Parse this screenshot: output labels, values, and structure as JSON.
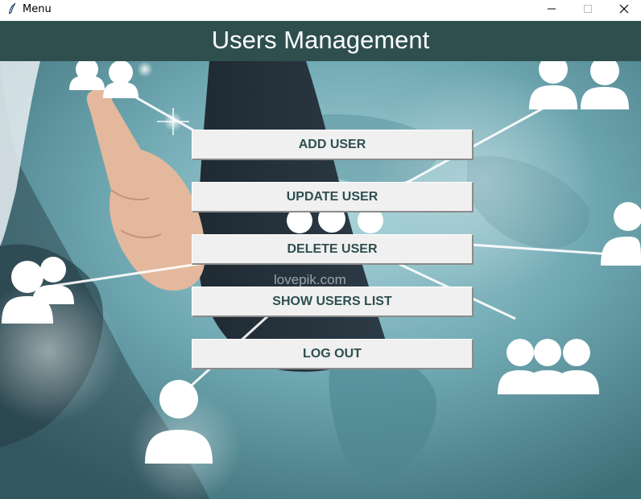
{
  "window": {
    "title": "Menu",
    "app_icon": "feather-icon",
    "controls": [
      "minimize-icon",
      "maximize-icon",
      "close-icon"
    ]
  },
  "header": {
    "title": "Users Management",
    "background": "#2f4f4f",
    "color": "#ffffff"
  },
  "background": {
    "watermark": "lovepik.com"
  },
  "menu": {
    "add_user": "ADD USER",
    "update_user": "UPDATE USER",
    "delete_user": "DELETE USER",
    "show_users_list": "SHOW USERS LIST",
    "log_out": "LOG OUT",
    "button_text_color": "#2f4f4f",
    "button_background": "#f0f0f0"
  }
}
